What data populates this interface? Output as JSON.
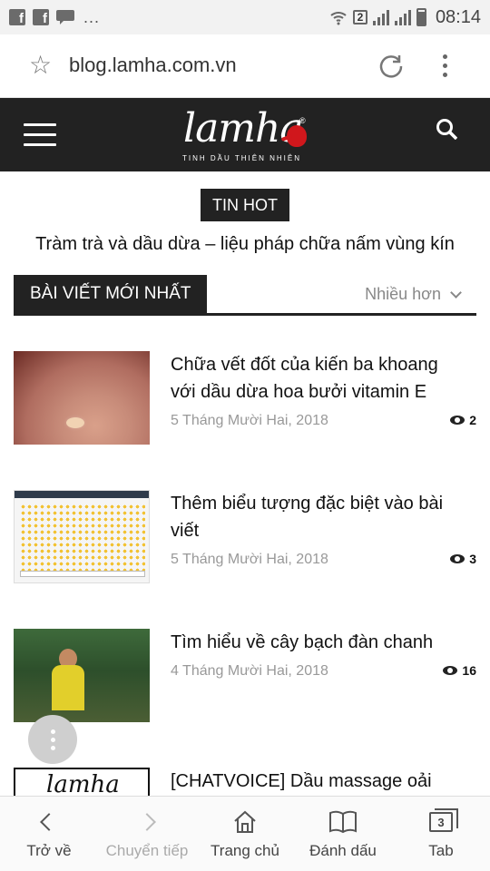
{
  "status_bar": {
    "sim_badge": "2",
    "time": "08:14",
    "overflow": "..."
  },
  "browser": {
    "url": "blog.lamha.com.vn"
  },
  "site": {
    "logo_text": "lamha",
    "logo_registered": "®",
    "logo_tagline": "TINH DẦU THIÊN NHIÊN"
  },
  "tin_hot": {
    "badge": "TIN HOT",
    "headline": "Tràm trà và dầu dừa – liệu pháp chữa nấm vùng kín"
  },
  "section": {
    "title": "BÀI VIẾT MỚI NHẤT",
    "more_label": "Nhiều hơn"
  },
  "articles": [
    {
      "title": "Chữa vết đốt của kiến ba khoang với dầu dừa hoa bưởi vitamin E",
      "date": "5 Tháng Mười Hai, 2018",
      "views": "2"
    },
    {
      "title": "Thêm biểu tượng đặc biệt vào bài viết",
      "date": "5 Tháng Mười Hai, 2018",
      "views": "3"
    },
    {
      "title": "Tìm hiểu về cây bạch đàn chanh",
      "date": "4 Tháng Mười Hai, 2018",
      "views": "16"
    },
    {
      "title": "[CHATVOICE] Dầu massage oải",
      "date": "",
      "views": ""
    }
  ],
  "bottom_nav": {
    "back": "Trở về",
    "forward": "Chuyển tiếp",
    "home": "Trang chủ",
    "bookmarks": "Đánh dấu",
    "tabs": "Tab",
    "tab_count": "3"
  },
  "colors": {
    "header_bg": "#222222",
    "accent_red": "#d0171c",
    "muted_text": "#999999"
  }
}
